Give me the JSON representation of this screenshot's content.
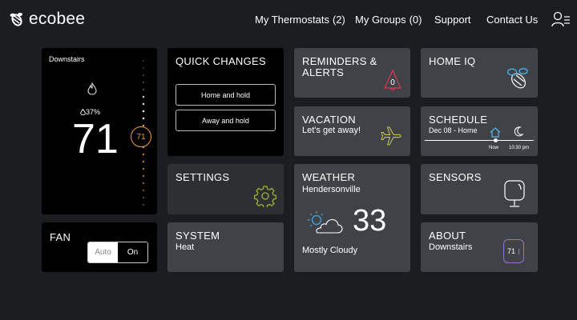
{
  "header": {
    "logo_text": "ecobee",
    "nav": [
      {
        "label": "My Thermostats",
        "count": "(2)"
      },
      {
        "label": "My Groups",
        "count": "(0)"
      },
      {
        "label": "Support"
      },
      {
        "label": "Contact Us"
      }
    ]
  },
  "thermostat": {
    "location": "Downstairs",
    "humidity": "37%",
    "current_temp": "71",
    "setpoint": "71"
  },
  "fan": {
    "title": "FAN",
    "options": [
      "Auto",
      "On"
    ],
    "selected": "On"
  },
  "quick_changes": {
    "title": "QUICK CHANGES",
    "buttons": [
      "Home and hold",
      "Away and hold"
    ]
  },
  "settings": {
    "title": "SETTINGS"
  },
  "system": {
    "title": "SYSTEM",
    "mode": "Heat"
  },
  "reminders": {
    "title_line1": "REMINDERS &",
    "title_line2": "ALERTS",
    "count": "0"
  },
  "vacation": {
    "title": "VACATION",
    "subtitle": "Let's get away!"
  },
  "weather": {
    "title": "WEATHER",
    "location": "Hendersonville",
    "temp": "33",
    "condition": "Mostly Cloudy"
  },
  "home_iq": {
    "title": "HOME IQ"
  },
  "schedule": {
    "title": "SCHEDULE",
    "subtitle": "Dec 08 - Home",
    "now_label": "Now",
    "next_time": "10:30 pm"
  },
  "sensors": {
    "title": "SENSORS"
  },
  "about": {
    "title": "ABOUT",
    "location": "Downstairs",
    "badge": "71"
  },
  "colors": {
    "background": "#1b1d20",
    "tile_black": "#000000",
    "tile_gray": "#2d3033",
    "tile_light": "#3f4347",
    "setpoint_orange": "#f0a040",
    "alert_red": "#d63a55",
    "vacation_yellow": "#c6c24a",
    "settings_green": "#9bb33a",
    "weather_blue": "#4aa8d8",
    "home_blue": "#5bb4e8",
    "about_purple": "#9b6fd0"
  }
}
